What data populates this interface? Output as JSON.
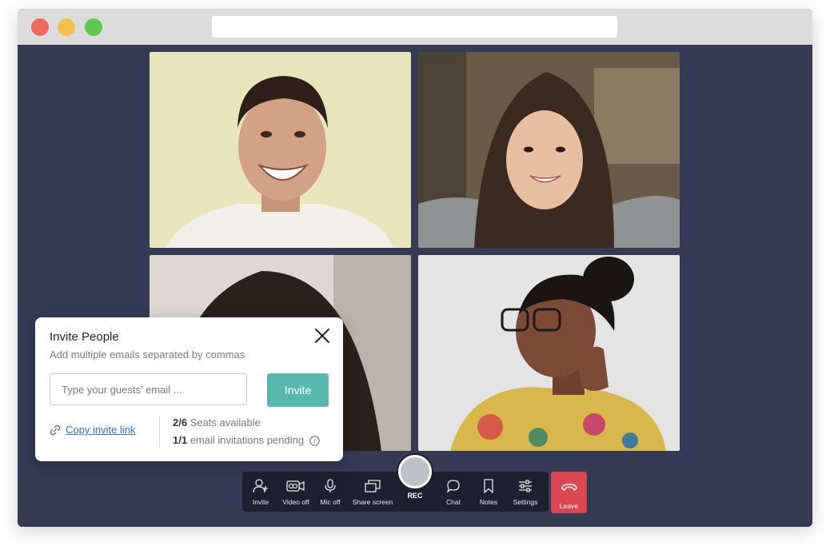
{
  "invite": {
    "title": "Invite People",
    "subtitle": "Add multiple emails separated by commas",
    "email_placeholder": "Type your guests’ email ...",
    "invite_button": "Invite",
    "copy_link": "Copy invite link",
    "seats_count": "2/6",
    "seats_label": " Seats available",
    "pending_count": "1/1",
    "pending_label": " email invitations pending"
  },
  "toolbar": {
    "invite": "Invite",
    "video": "Video off",
    "mic": "Mic off",
    "share": "Share screen",
    "rec": "REC",
    "chat": "Chat",
    "notes": "Notes",
    "settings": "Settings",
    "leave": "Leave"
  },
  "colors": {
    "stage": "#333b55",
    "accent": "#59b8ae",
    "leave": "#d94852",
    "toolbar": "#1e2030",
    "link": "#2f6ec2"
  },
  "participants": [
    {
      "icon": "participant-video-man-smiling"
    },
    {
      "icon": "participant-video-woman-smiling"
    },
    {
      "icon": "participant-video-woman-curly-hair"
    },
    {
      "icon": "participant-video-woman-glasses"
    }
  ]
}
